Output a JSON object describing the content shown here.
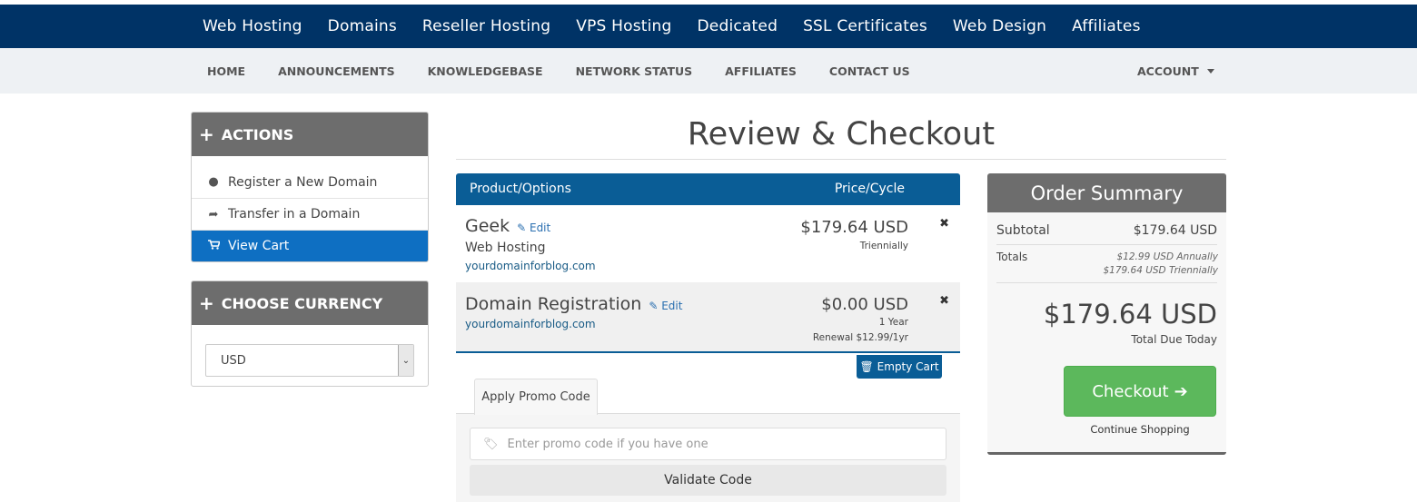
{
  "top_nav": [
    "Web Hosting",
    "Domains",
    "Reseller Hosting",
    "VPS Hosting",
    "Dedicated",
    "SSL Certificates",
    "Web Design",
    "Affiliates"
  ],
  "sub_nav": [
    "HOME",
    "ANNOUNCEMENTS",
    "KNOWLEDGEBASE",
    "NETWORK STATUS",
    "AFFILIATES",
    "CONTACT US"
  ],
  "account_label": "ACCOUNT",
  "sidebar": {
    "actions_title": "ACTIONS",
    "actions": [
      {
        "label": "Register a New Domain",
        "icon": "globe-icon"
      },
      {
        "label": "Transfer in a Domain",
        "icon": "share-arrow-icon"
      },
      {
        "label": "View Cart",
        "icon": "cart-icon"
      }
    ],
    "currency_title": "CHOOSE CURRENCY",
    "currency_value": "USD"
  },
  "page_title": "Review & Checkout",
  "cart": {
    "col_product": "Product/Options",
    "col_price": "Price/Cycle",
    "edit_label": "Edit",
    "items": [
      {
        "name": "Geek",
        "group": "Web Hosting",
        "domain": "yourdomainforblog.com",
        "price": "$179.64 USD",
        "cycle": "Triennially",
        "renewal": ""
      },
      {
        "name": "Domain Registration",
        "group": "",
        "domain": "yourdomainforblog.com",
        "price": "$0.00 USD",
        "cycle": "1 Year",
        "renewal": "Renewal $12.99/1yr"
      }
    ],
    "empty_cart": "Empty Cart"
  },
  "promo": {
    "tab_label": "Apply Promo Code",
    "placeholder": "Enter promo code if you have one",
    "validate_label": "Validate Code"
  },
  "summary": {
    "title": "Order Summary",
    "subtotal_label": "Subtotal",
    "subtotal_value": "$179.64 USD",
    "totals_label": "Totals",
    "totals_lines": [
      "$12.99 USD Annually",
      "$179.64 USD Triennially"
    ],
    "total_due": "$179.64 USD",
    "total_due_label": "Total Due Today",
    "checkout_label": "Checkout",
    "continue_label": "Continue Shopping"
  },
  "colors": {
    "top_bar": "#003366",
    "cart_header": "#0a5d96",
    "active_item": "#0e6fc2",
    "checkout_green": "#5cb85c",
    "panel_header": "#6d6d6d"
  }
}
